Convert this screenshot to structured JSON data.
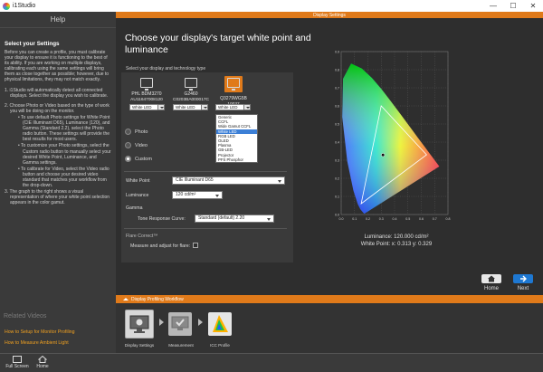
{
  "window": {
    "title": "i1Studio",
    "controls": [
      "—",
      "☐",
      "✕"
    ]
  },
  "help": {
    "title": "Help",
    "section_title": "Select your Settings",
    "intro": "Before you can create a profile, you must calibrate your display to ensure it is functioning to the best of its ability. If you are working on multiple displays, calibrating each using the same settings will bring them as close together as possible; however, due to physical limitations, they may not match exactly.",
    "step1": "1. i1Studio will automatically detect all connected displays. Select the display you wish to calibrate.",
    "step2": "2. Choose Photo or Video based on the type of work you will be doing on the monitor.",
    "step2_bullet1": "• To use default Photo settings for White Point (CIE Illuminant D65), Luminance (120), and Gamma (Standard 2.2), select the Photo radio button. These settings will provide the best results for most users.",
    "step2_bullet2": "• To customize your Photo settings, select the Custom radio button to manually select your desired White Point, Luminance, and Gamma settings.",
    "step2_bullet3": "• To calibrate for Video, select the Video radio button and choose your desired video standard that matches your workflow from the drop-down.",
    "step3": "3. The graph to the right shows a visual representation of where your white point selection appears in the color gamut.",
    "related_title": "Related Videos",
    "related_links": [
      "How to Setup for Monitor Profiling",
      "How to Measure Ambient Light"
    ]
  },
  "header": {
    "strip_label": "Display Settings"
  },
  "main": {
    "title": "Choose your display's target white point and luminance",
    "select_label": "Select your display and technology type",
    "displays": [
      {
        "name": "PHL BDM3270",
        "serial": "AU11647008120",
        "tech": "White LED",
        "selected": false
      },
      {
        "name": "G2460",
        "serial": "C0203BA000017C",
        "tech": "White LED",
        "selected": false
      },
      {
        "name": "Q3279WG5B",
        "serial": "10037",
        "tech": "White LED",
        "selected": true
      }
    ],
    "tech_options": [
      "Generic",
      "CCFL",
      "Wide Gamut CCFL",
      "White LED",
      "RGB LED",
      "OLED",
      "Plasma",
      "GB-LED",
      "Projector",
      "PFS Phosphor"
    ],
    "tech_highlight": "White LED",
    "radios": {
      "photo": "Photo",
      "video": "Video",
      "custom": "Custom",
      "selected": "custom"
    },
    "white_point": {
      "label": "White Point",
      "value": "CIE Illuminant D65"
    },
    "luminance": {
      "label": "Luminance",
      "value": "120 cd/m²"
    },
    "gamma": {
      "label": "Gamma",
      "trc_label": "Tone Response Curve:",
      "trc_value": "Standard (default) 2.20"
    },
    "flare": {
      "title": "Flare Correct™",
      "measure_label": "Measure and adjust for flare:"
    },
    "luminance_readout": "Luminance: 120.000 cd/m²",
    "white_point_readout": "White Point: x: 0.313  y: 0.329"
  },
  "chart_data": {
    "type": "scatter",
    "x_ticks": [
      "0.0",
      "0.1",
      "0.2",
      "0.3",
      "0.4",
      "0.5",
      "0.6",
      "0.7",
      "0.8"
    ],
    "y_ticks": [
      "0.0",
      "0.1",
      "0.2",
      "0.3",
      "0.4",
      "0.5",
      "0.6",
      "0.7",
      "0.8",
      "0.9"
    ],
    "xlim": [
      0,
      0.8
    ],
    "ylim": [
      0,
      0.9
    ],
    "grid": true,
    "gamut": [
      [
        0.64,
        0.33
      ],
      [
        0.3,
        0.6
      ],
      [
        0.15,
        0.06
      ]
    ],
    "white_point": [
      0.313,
      0.329
    ],
    "spectral_locus": [
      [
        0.1741,
        0.005
      ],
      [
        0.1733,
        0.0048
      ],
      [
        0.1666,
        0.0089
      ],
      [
        0.144,
        0.0297
      ],
      [
        0.1241,
        0.0578
      ],
      [
        0.0913,
        0.1327
      ],
      [
        0.0454,
        0.295
      ],
      [
        0.0082,
        0.5384
      ],
      [
        0.0139,
        0.7502
      ],
      [
        0.0743,
        0.8338
      ],
      [
        0.1547,
        0.8059
      ],
      [
        0.2296,
        0.7543
      ],
      [
        0.3016,
        0.6923
      ],
      [
        0.3731,
        0.6245
      ],
      [
        0.4441,
        0.5547
      ],
      [
        0.5125,
        0.4866
      ],
      [
        0.5752,
        0.4242
      ],
      [
        0.627,
        0.3725
      ],
      [
        0.6658,
        0.334
      ],
      [
        0.6915,
        0.3083
      ],
      [
        0.7347,
        0.2653
      ]
    ]
  },
  "nav": {
    "home": "Home",
    "next": "Next"
  },
  "workflow": {
    "strip_label": "Display Profiling Workflow",
    "steps": [
      "Display Settings",
      "Measurement",
      "ICC Profile"
    ]
  },
  "bottombar": {
    "fullscreen": "Full Screen",
    "home": "Home"
  }
}
